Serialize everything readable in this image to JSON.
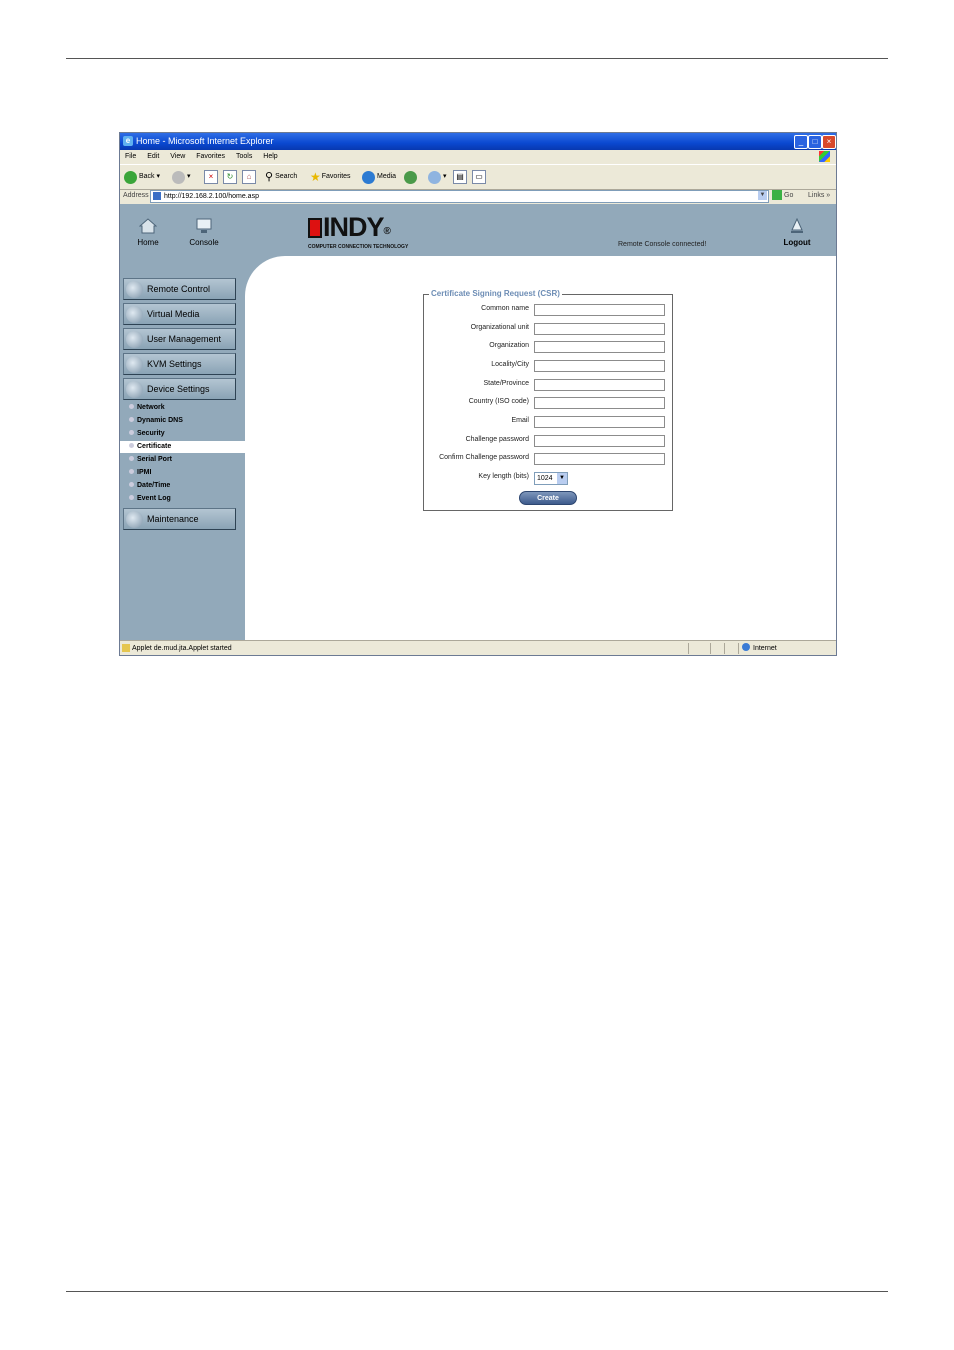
{
  "window": {
    "title": "Home - Microsoft Internet Explorer"
  },
  "menu": [
    "File",
    "Edit",
    "View",
    "Favorites",
    "Tools",
    "Help"
  ],
  "toolbar": {
    "back": "Back",
    "search": "Search",
    "favorites": "Favorites",
    "media": "Media"
  },
  "address": {
    "label": "Address",
    "url": "http://192.168.2.100/home.asp",
    "go": "Go",
    "links": "Links"
  },
  "header": {
    "home": "Home",
    "console": "Console",
    "logo_text": "INDY",
    "logo_tagline": "COMPUTER CONNECTION TECHNOLOGY",
    "status": "Remote Console connected!",
    "logout": "Logout"
  },
  "sidebar": {
    "buttons": [
      "Remote Control",
      "Virtual Media",
      "User Management",
      "KVM Settings",
      "Device Settings"
    ],
    "subitems": [
      "Network",
      "Dynamic DNS",
      "Security",
      "Certificate",
      "Serial Port",
      "IPMI",
      "Date/Time",
      "Event Log"
    ],
    "active": "Certificate",
    "maintenance": "Maintenance"
  },
  "csr": {
    "legend": "Certificate Signing Request (CSR)",
    "fields": [
      {
        "label": "Common name",
        "value": ""
      },
      {
        "label": "Organizational unit",
        "value": ""
      },
      {
        "label": "Organization",
        "value": ""
      },
      {
        "label": "Locality/City",
        "value": ""
      },
      {
        "label": "State/Province",
        "value": ""
      },
      {
        "label": "Country (ISO code)",
        "value": ""
      },
      {
        "label": "Email",
        "value": ""
      },
      {
        "label": "Challenge password",
        "value": ""
      },
      {
        "label": "Confirm Challenge password",
        "value": ""
      }
    ],
    "key_length_label": "Key length (bits)",
    "key_length_value": "1024",
    "create_button": "Create"
  },
  "statusbar": {
    "text": "Applet de.mud.jta.Applet started",
    "zone": "Internet"
  },
  "colors": {
    "titlebar": "#0a48d0",
    "panel": "#92a9ba",
    "legend": "#6d8db5",
    "logo_red": "#dd1111"
  }
}
